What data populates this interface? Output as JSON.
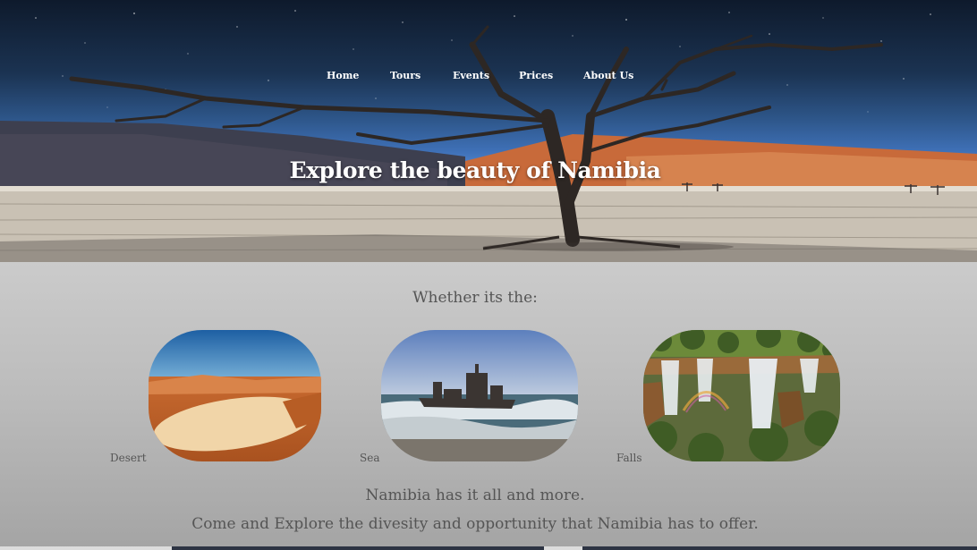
{
  "nav": {
    "items": [
      {
        "label": "Home"
      },
      {
        "label": "Tours"
      },
      {
        "label": "Events"
      },
      {
        "label": "Prices"
      },
      {
        "label": "About Us"
      }
    ]
  },
  "hero": {
    "title": "Explore the beauty of Namibia"
  },
  "intro": {
    "text": "Whether its the:"
  },
  "cards": [
    {
      "label": "Desert"
    },
    {
      "label": "Sea"
    },
    {
      "label": "Falls"
    }
  ],
  "outro": {
    "line1": "Namibia has it all and more.",
    "line2": "Come and Explore the divesity and opportunity that Namibia has to offer."
  },
  "colors": {
    "text_gray": "#555555",
    "hero_text": "#ffffff",
    "dune": "#c86a3a",
    "sky_blue": "#3f71b8"
  }
}
